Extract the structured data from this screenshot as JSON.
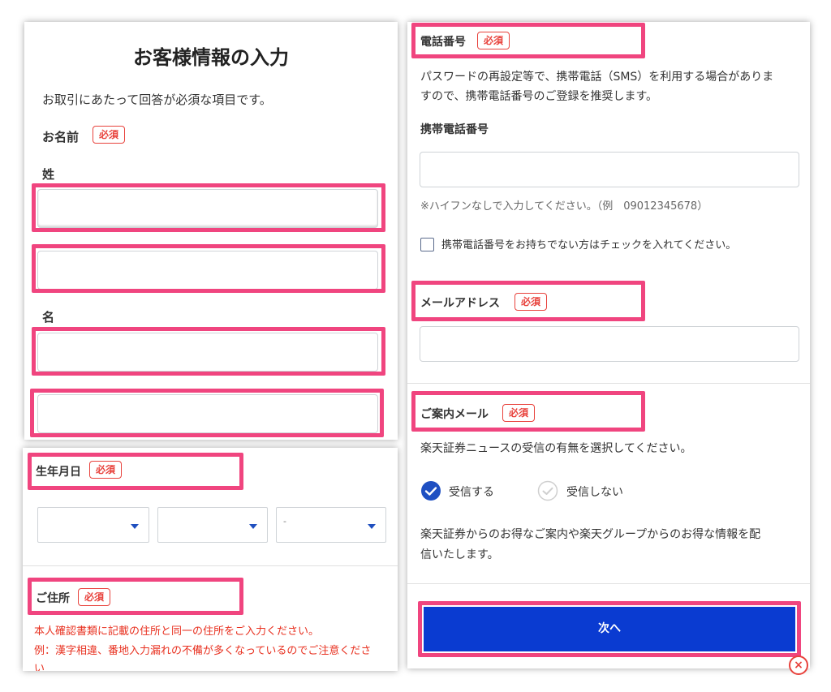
{
  "panel_a": {
    "title": "お客様情報の入力",
    "intro": "お取引にあたって回答が必須な項目です。",
    "name_label": "お名前",
    "required": "必須",
    "sei_label": "姓",
    "mei_label": "名"
  },
  "panel_b": {
    "birthday_label": "生年月日",
    "required": "必須",
    "day_placeholder": "-",
    "address_label": "ご住所",
    "address_required": "必須",
    "address_note_1": "本人確認書類に記載の住所と同一の住所をご入力ください。",
    "address_note_2": "例：漢字相違、番地入力漏れの不備が多くなっているのでご注意くださ",
    "address_note_3": "い"
  },
  "panel_c": {
    "phone_label": "電話番号",
    "required": "必須",
    "phone_desc_1": "パスワードの再設定等で、携帯電話（SMS）を利用する場合がありま",
    "phone_desc_2": "すので、携帯電話番号のご登録を推奨します。",
    "mobile_label": "携帯電話番号",
    "mobile_hint": "※ハイフンなしで入力してください。（例　09012345678）",
    "no_mobile_check": "携帯電話番号をお持ちでない方はチェックを入れてください。",
    "email_label": "メールアドレス",
    "guide_label": "ご案内メール",
    "guide_desc": "楽天証券ニュースの受信の有無を選択してください。",
    "receive": "受信する",
    "not_receive": "受信しない",
    "promo_1": "楽天証券からのお得なご案内や楽天グループからのお得な情報を配",
    "promo_2": "信いたします。",
    "next_button": "次へ"
  },
  "colors": {
    "highlight": "#f0457f",
    "required": "#e8423c",
    "primary_button": "#0a3bd1",
    "check_selected": "#1e4fc2",
    "note_red": "#e8301f"
  },
  "icons": [
    "check-circle-icon",
    "check-circle-outline-icon",
    "chevron-down-icon",
    "close-icon"
  ]
}
